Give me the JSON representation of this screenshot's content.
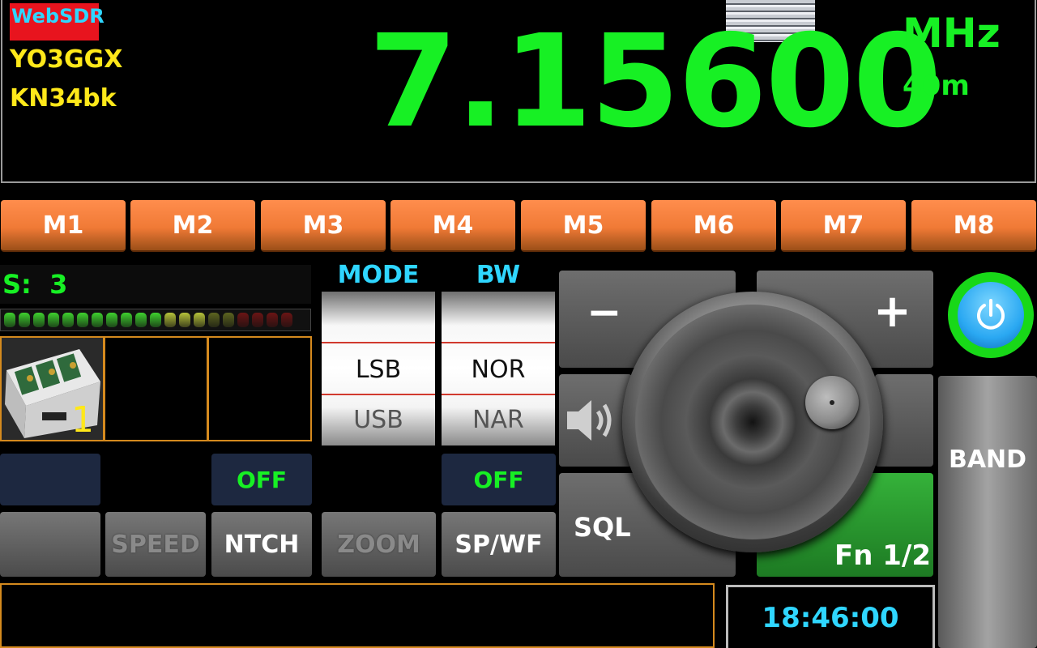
{
  "header": {
    "app_name": "WebSDR",
    "callsign": "YO3GGX",
    "locator": "KN34bk",
    "frequency": "7.15600",
    "unit": "MHz",
    "band": "40m"
  },
  "memories": [
    "M1",
    "M2",
    "M3",
    "M4",
    "M5",
    "M6",
    "M7",
    "M8"
  ],
  "smeter": {
    "label": "S:  3",
    "segments": 20,
    "lit": 14
  },
  "thumbnails": {
    "slot1_number": "1"
  },
  "mode": {
    "header": "MODE",
    "selected": "LSB",
    "next": "USB"
  },
  "bw": {
    "header": "BW",
    "selected": "NOR",
    "next": "NAR"
  },
  "toggles": {
    "ntch_state": "OFF",
    "spwf_state": "OFF"
  },
  "buttons": {
    "speed": "SPEED",
    "ntch": "NTCH",
    "zoom": "ZOOM",
    "spwf": "SP/WF",
    "minus": "−",
    "plus": "+",
    "sql": "SQL",
    "fn": "Fn 1/2",
    "band": "BAND"
  },
  "clock": "18:46:00",
  "colors": {
    "frequency": "#17f024",
    "accent_cyan": "#2fd6ff",
    "memory_orange": "#f07a36",
    "fn_green": "#2aa82f",
    "border_orange": "#d58a1e"
  }
}
